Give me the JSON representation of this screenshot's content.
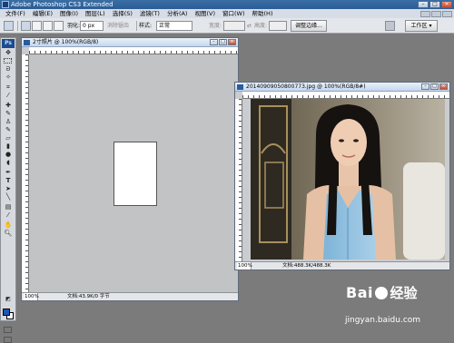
{
  "app": {
    "title": "Adobe Photoshop CS3 Extended"
  },
  "menu": [
    "文件(F)",
    "编辑(E)",
    "图像(I)",
    "图层(L)",
    "选择(S)",
    "滤镜(T)",
    "分析(A)",
    "视图(V)",
    "窗口(W)",
    "帮助(H)"
  ],
  "options": {
    "feather_label": "羽化:",
    "feather_value": "0 px",
    "antialias_label": "消除锯齿",
    "style_label": "样式:",
    "style_value": "正常",
    "width_label": "宽度:",
    "height_label": "高度:",
    "refine_edge_button": "调整边缘...",
    "workspace_button": "工作区 ▾"
  },
  "doc1": {
    "title": "2寸照片 @ 100%(RGB/8)",
    "zoom": "100%",
    "status": "文档:43.9K/0 字节"
  },
  "doc2": {
    "title": "20140909050800773.jpg @ 100%(RGB/8#)",
    "zoom": "100%",
    "status": "文档:488.3K/488.3K"
  },
  "watermark": {
    "brand_prefix": "Bai",
    "brand_suffix": "经验",
    "url": "jingyan.baidu.com"
  },
  "colors": {
    "foreground": "#1d57b5",
    "background": "#ffffff",
    "workspace": "#7b7b7b"
  },
  "icons": [
    "move-icon",
    "marquee-icon",
    "lasso-icon",
    "magic-wand-icon",
    "crop-icon",
    "eyedropper-icon",
    "healing-brush-icon",
    "brush-icon",
    "clone-stamp-icon",
    "history-brush-icon",
    "eraser-icon",
    "gradient-icon",
    "blur-icon",
    "dodge-icon",
    "pen-icon",
    "type-icon",
    "path-selection-icon",
    "shape-icon",
    "notes-icon",
    "eyedropper-2-icon",
    "hand-icon",
    "zoom-icon"
  ]
}
